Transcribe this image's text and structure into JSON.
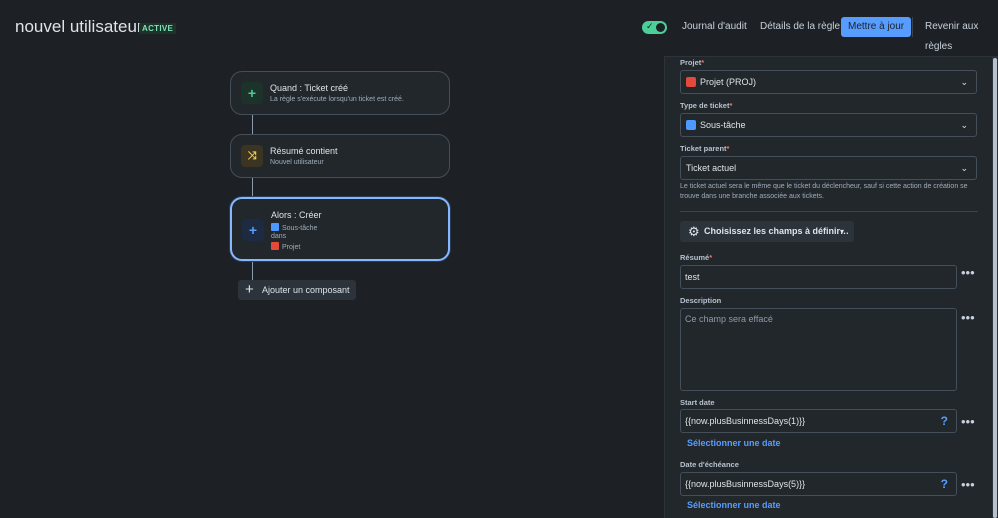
{
  "header": {
    "title": "nouvel utilisateur",
    "status": "ACTIVE",
    "toggle_state": "on",
    "buttons": {
      "audit": "Journal d'audit",
      "details": "Détails de la règle",
      "update": "Mettre à jour",
      "revert": "Revenir aux règles"
    }
  },
  "canvas": {
    "trigger": {
      "title": "Quand : Ticket créé",
      "subtitle": "La règle s'exécute lorsqu'un ticket est créé."
    },
    "condition": {
      "title": "Résumé contient",
      "subtitle": "Nouvel utilisateur"
    },
    "action": {
      "title": "Alors : Créer",
      "line1": "Sous-tâche",
      "line2": "dans",
      "line3": "Projet"
    },
    "add_component": "Ajouter un composant"
  },
  "panel": {
    "project": {
      "label": "Projet",
      "value": "Projet (PROJ)"
    },
    "issue_type": {
      "label": "Type de ticket",
      "value": "Sous-tâche"
    },
    "parent": {
      "label": "Ticket parent",
      "value": "Ticket actuel"
    },
    "help": "Le ticket actuel sera le même que le ticket du déclencheur, sauf si cette action de création se trouve dans une branche associée aux tickets.",
    "choose_fields": "Choisissez les champs à définir…",
    "summary": {
      "label": "Résumé",
      "value": "test"
    },
    "description": {
      "label": "Description",
      "placeholder": "Ce champ sera effacé"
    },
    "start_date": {
      "label": "Start date",
      "value": "{{now.plusBusinnessDays(1)}}",
      "link": "Sélectionner une date"
    },
    "due_date": {
      "label": "Date d'échéance",
      "value": "{{now.plusBusinnessDays(5)}}",
      "link": "Sélectionner une date"
    },
    "required_mark": "*"
  },
  "colors": {
    "background": "#1d2125",
    "accent": "#579dff",
    "toggle": "#4bce97",
    "selected_border": "#85b8ff"
  }
}
